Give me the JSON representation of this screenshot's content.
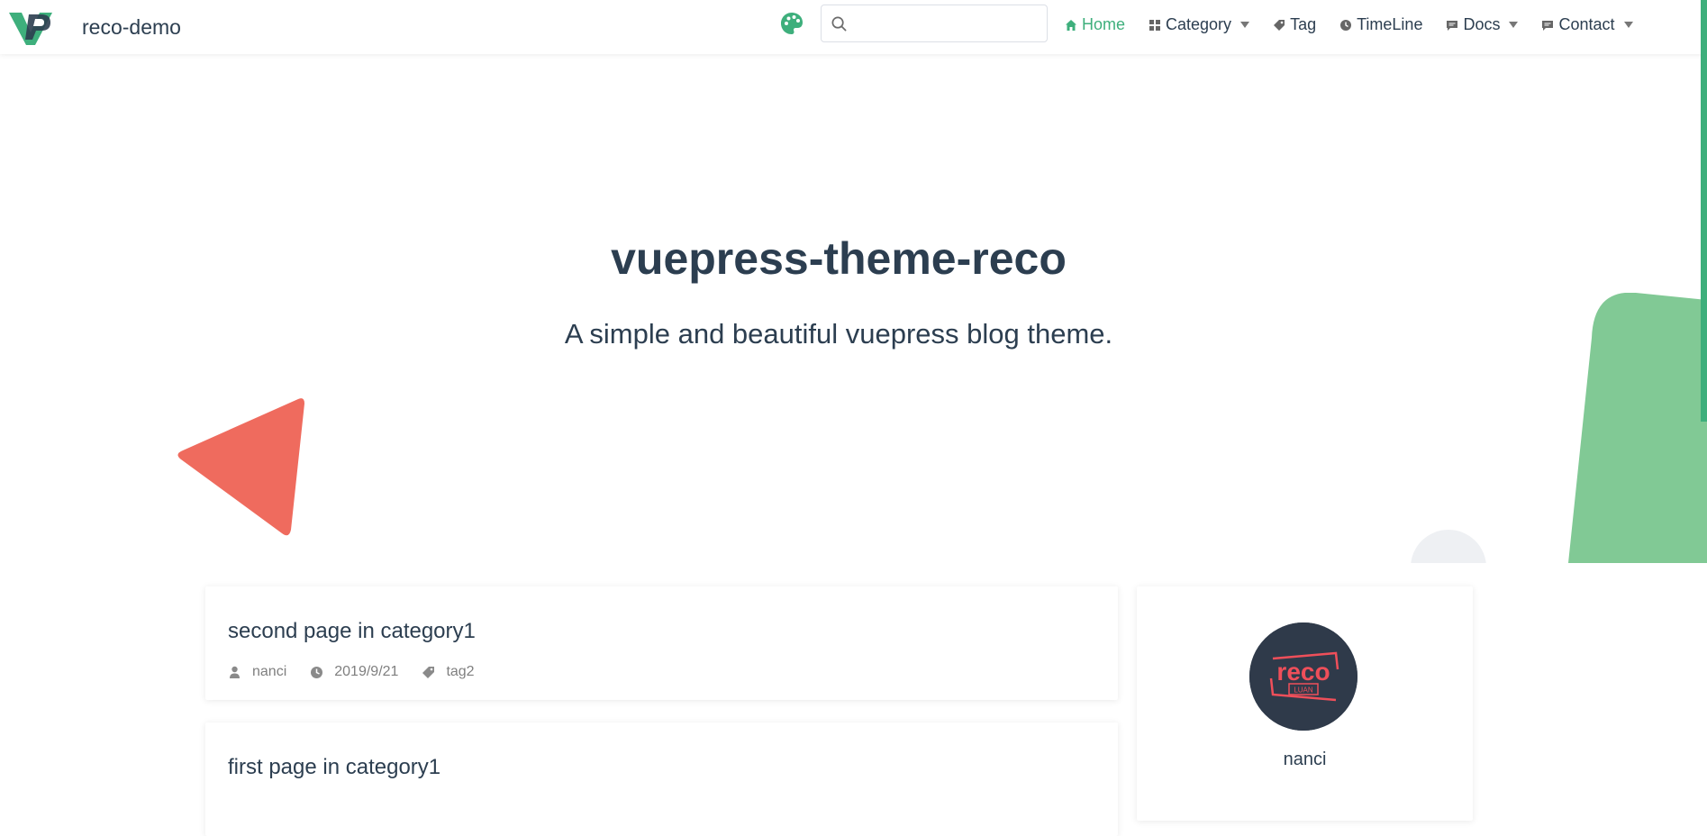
{
  "brand": {
    "title": "reco-demo",
    "logo_icon": "vp-logo-icon"
  },
  "search": {
    "placeholder": "",
    "value": ""
  },
  "nav": {
    "items": [
      {
        "label": "Home",
        "icon": "home-icon",
        "active": true,
        "dropdown": false
      },
      {
        "label": "Category",
        "icon": "category-icon",
        "active": false,
        "dropdown": true
      },
      {
        "label": "Tag",
        "icon": "tag-icon",
        "active": false,
        "dropdown": false
      },
      {
        "label": "TimeLine",
        "icon": "clock-icon",
        "active": false,
        "dropdown": false
      },
      {
        "label": "Docs",
        "icon": "docs-icon",
        "active": false,
        "dropdown": true
      },
      {
        "label": "Contact",
        "icon": "contact-icon",
        "active": false,
        "dropdown": true
      }
    ]
  },
  "hero": {
    "title": "vuepress-theme-reco",
    "description": "A simple and beautiful vuepress blog theme."
  },
  "posts": [
    {
      "title": "second page in category1",
      "author": "nanci",
      "date": "2019/9/21",
      "tag": "tag2"
    },
    {
      "title": "first page in category1",
      "author": "",
      "date": "",
      "tag": ""
    }
  ],
  "sidebar": {
    "author_name": "nanci",
    "avatar_text": "reco",
    "avatar_subtext": "LUAN"
  },
  "colors": {
    "accent": "#3eaf7c",
    "triangle": "#ef6b5e",
    "green_shape": "#81c995",
    "text": "#2c3e50",
    "meta": "#7f7f7f"
  }
}
